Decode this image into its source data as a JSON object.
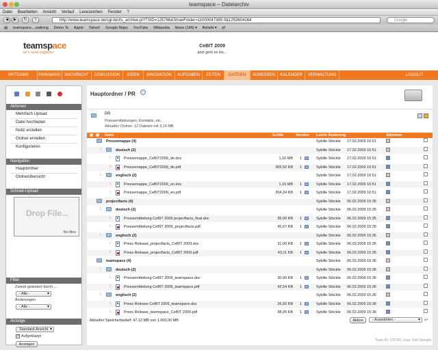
{
  "browser": {
    "window_title": "teamspace – Dateiarchiv",
    "menus": [
      "Datei",
      "Bearbeiten",
      "Ansicht",
      "Verlauf",
      "Lesezeichen",
      "Fenster",
      "?"
    ],
    "url": "http://www.teamspace.de/cgi-bin/ts_archive.pl?TSID=125766&ShowFolder=11000047385 0&1253604164",
    "search_placeholder": "Google",
    "bookmarks": [
      "teamspace....waltung",
      "Demo Ts",
      "Apple",
      "Yahoo!",
      "Google Maps",
      "YouTube",
      "Wikipedia",
      "News (146) ▾",
      "Beliebt ▾",
      "pf"
    ]
  },
  "header": {
    "logo_text": "teamspace",
    "slogan": "let's work together",
    "event_title": "CeBIT 2009",
    "event_subtitle": "jetzt geht es los..."
  },
  "nav": {
    "items": [
      "MYTEAMS",
      "PINNWAND",
      "NACHRICHT",
      "DISKUSSION",
      "IDEEN",
      "INNOVATION",
      "AUFGABEN",
      "ZEITEN",
      "DATEIEN",
      "ADRESSEN",
      "KALENDER",
      "VERWALTUNG"
    ],
    "active": "DATEIEN",
    "logout": "LOGOUT"
  },
  "sidebar": {
    "aktionen_title": "Aktionen",
    "aktionen": [
      "Mehrfach Upload",
      "Datei hochladen",
      "Notiz erstellen",
      "Ordner erstellen",
      "Konfigurieren"
    ],
    "navigation_title": "Navigation",
    "navigation": [
      "Hauptordner",
      "Ordnerübersicht"
    ],
    "schnell_upload_title": "Schnell-Upload",
    "drop_text": "Drop File...",
    "no_files": "No files",
    "filter_title": "Filter",
    "filter_label1": "Zuletzt geändert durch ...",
    "filter_select1": "- Alle -",
    "filter_label2": "Änderungen",
    "filter_select2": "- Alle -",
    "anzeige_title": "Anzeige",
    "anzeige_select": "Standard-Ansicht",
    "aufgeklappt_label": "Aufgeklappt",
    "anzeigen_button": "Anzeigen"
  },
  "main": {
    "breadcrumb": "Hauptordner / PR",
    "folder_name": "PR",
    "folder_desc": "Pressemitteilungen, Kontakte, etc.",
    "folder_info": "Aktueller Ordner: 12 Dateien mit 3,19 MB",
    "columns": {
      "datei": "Datei",
      "groesse": "Größe",
      "versionen": "Version",
      "letzte_aenderung": "Letzte Änderung",
      "aktionen": "Aktionen"
    },
    "rows": [
      {
        "kind": "folder",
        "level": 0,
        "name": "Pressemappe (4)",
        "size": "",
        "ver": "",
        "user": "Sybille Stöckle",
        "date": "17.02.2009 16:51"
      },
      {
        "kind": "folder",
        "level": 1,
        "name": "deutsch (2)",
        "size": "",
        "ver": "",
        "user": "Sybille Stöckle",
        "date": "17.02.2009 16:51"
      },
      {
        "kind": "doc",
        "level": 2,
        "name": "Pressemappe_CeBIT2009_de.doc",
        "size": "1,16 MB",
        "ver": "1",
        "user": "Sybille Stöckle",
        "date": "17.02.2009 16:51"
      },
      {
        "kind": "pdf",
        "level": 2,
        "name": "Pressemappe_CeBIT2009_de.pdf",
        "size": "305,50 KB",
        "ver": "1",
        "user": "Sybille Stöckle",
        "date": "17.02.2009 16:51"
      },
      {
        "kind": "folder",
        "level": 1,
        "name": "englisch (2)",
        "size": "",
        "ver": "",
        "user": "Sybille Stöckle",
        "date": "17.02.2009 16:51"
      },
      {
        "kind": "doc",
        "level": 2,
        "name": "Pressemappe_CeBIT2009_en.doc",
        "size": "1,15 MB",
        "ver": "1",
        "user": "Sybille Stöckle",
        "date": "17.02.2009 16:51"
      },
      {
        "kind": "pdf",
        "level": 2,
        "name": "Pressemappe_CeBIT2009_en.pdf",
        "size": "304,34 KB",
        "ver": "1",
        "user": "Sybille Stöckle",
        "date": "17.02.2009 16:51"
      },
      {
        "kind": "folder",
        "level": 0,
        "name": "projectfacts (4)",
        "size": "",
        "ver": "",
        "user": "Sybille Stöckle",
        "date": "06.02.2009 15:35"
      },
      {
        "kind": "folder",
        "level": 1,
        "name": "deutsch (2)",
        "size": "",
        "ver": "",
        "user": "Sybille Stöckle",
        "date": "06.02.2009 15:35"
      },
      {
        "kind": "doc",
        "level": 2,
        "name": "Pressemitteilung CeBIT 2009 projectfacts_final.doc",
        "size": "35,00 KB",
        "ver": "1",
        "user": "Sybille Stöckle",
        "date": "06.02.2009 15:35"
      },
      {
        "kind": "pdf",
        "level": 2,
        "name": "Pressemitteilung CeBIT 2009_projectfacts.pdf",
        "size": "45,67 KB",
        "ver": "1",
        "user": "Sybille Stöckle",
        "date": "06.02.2009 15:35"
      },
      {
        "kind": "folder",
        "level": 1,
        "name": "englisch (2)",
        "size": "",
        "ver": "",
        "user": "Sybille Stöckle",
        "date": "06.02.2009 15:35"
      },
      {
        "kind": "doc",
        "level": 2,
        "name": "Press Release_projectfacts_CeBIT 2009.doc",
        "size": "31,00 KB",
        "ver": "1",
        "user": "Sybille Stöckle",
        "date": "06.02.2009 15:35"
      },
      {
        "kind": "pdf",
        "level": 2,
        "name": "Press Release_projectfacts_CeBIT 2009.pdf",
        "size": "43,11 KB",
        "ver": "1",
        "user": "Sybille Stöckle",
        "date": "06.02.2009 15:35"
      },
      {
        "kind": "folder",
        "level": 0,
        "name": "teamspace (4)",
        "size": "",
        "ver": "",
        "user": "Sybille Stöckle",
        "date": "06.02.2009 15:36"
      },
      {
        "kind": "folder",
        "level": 1,
        "name": "deutsch (2)",
        "size": "",
        "ver": "",
        "user": "Sybille Stöckle",
        "date": "06.02.2009 15:36"
      },
      {
        "kind": "doc",
        "level": 2,
        "name": "Pressemitteilung CeBIT 2009_teamspace.doc",
        "size": "30,00 KB",
        "ver": "1",
        "user": "Sybille Stöckle",
        "date": "06.02.2009 15:36"
      },
      {
        "kind": "pdf",
        "level": 2,
        "name": "Pressemitteilung CeBIT 2009_teamspace.pdf",
        "size": "42,54 KB",
        "ver": "1",
        "user": "Sybille Stöckle",
        "date": "06.02.2009 15:36"
      },
      {
        "kind": "folder",
        "level": 1,
        "name": "englisch (2)",
        "size": "",
        "ver": "",
        "user": "Sybille Stöckle",
        "date": "06.02.2009 15:36"
      },
      {
        "kind": "doc",
        "level": 2,
        "name": "Press Release CeBIT 2009_teamspace.doc",
        "size": "26,50 KB",
        "ver": "1",
        "user": "Sybille Stöckle",
        "date": "06.02.2009 15:36"
      },
      {
        "kind": "pdf",
        "level": 2,
        "name": "Press Release_teamspace_CeBIT 2009.pdf",
        "size": "38,05 KB",
        "ver": "1",
        "user": "Sybille Stöckle",
        "date": "06.02.2009 15:36"
      }
    ],
    "storage_text": "Aktueller Speicherbedarf: 47,12 MB von 1.000,00 MB",
    "aktion_button": "Aktion",
    "auswahl_select": "- Auswählen -"
  },
  "footer": {
    "team_id": "Team ID: 125766, User: Kati Spiegler"
  },
  "colors": {
    "accent": "#f07820",
    "sidebar_head": "#6d6d6d",
    "folder": "#9dbbd8"
  }
}
